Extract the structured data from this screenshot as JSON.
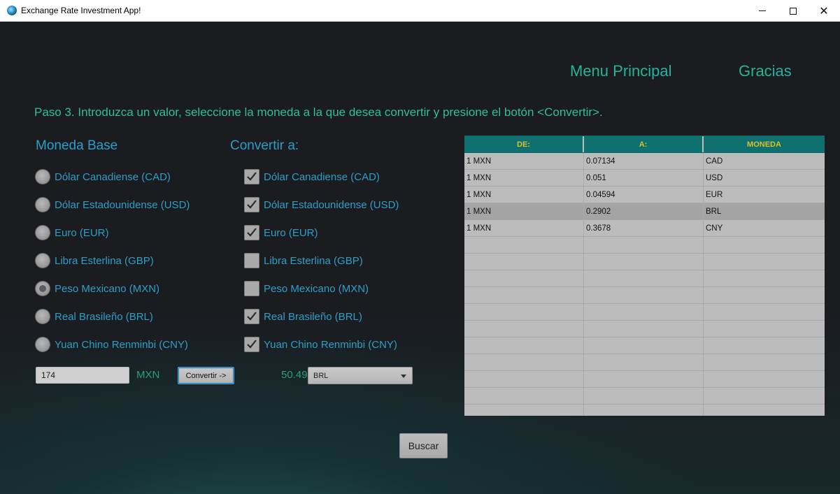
{
  "window": {
    "title": "Exchange Rate Investment App!",
    "controls": {
      "minimize": "minimize-icon",
      "maximize": "maximize-icon",
      "close": "close-icon"
    }
  },
  "nav": {
    "menu_principal": "Menu Principal",
    "gracias": "Gracias"
  },
  "instructions": "Paso 3. Introduzca un valor, seleccione la moneda a la que desea convertir y presione el botón <Convertir>.",
  "base_section": {
    "title": "Moneda Base",
    "options": [
      {
        "label": "Dólar Canadiense (CAD)",
        "selected": false
      },
      {
        "label": "Dólar Estadounidense (USD)",
        "selected": false
      },
      {
        "label": "Euro (EUR)",
        "selected": false
      },
      {
        "label": "Libra Esterlina (GBP)",
        "selected": false
      },
      {
        "label": "Peso Mexicano (MXN)",
        "selected": true
      },
      {
        "label": "Real Brasileño (BRL)",
        "selected": false
      },
      {
        "label": "Yuan Chino Renminbi (CNY)",
        "selected": false
      }
    ]
  },
  "convert_section": {
    "title": "Convertir a:",
    "options": [
      {
        "label": "Dólar Canadiense (CAD)",
        "checked": true
      },
      {
        "label": "Dólar Estadounidense (USD)",
        "checked": true
      },
      {
        "label": "Euro (EUR)",
        "checked": true
      },
      {
        "label": "Libra Esterlina (GBP)",
        "checked": false
      },
      {
        "label": "Peso Mexicano (MXN)",
        "checked": false
      },
      {
        "label": "Real Brasileño (BRL)",
        "checked": true
      },
      {
        "label": "Yuan Chino Renminbi (CNY)",
        "checked": true
      }
    ]
  },
  "converter": {
    "amount_value": "174",
    "base_code": "MXN",
    "convert_label": "Convertir ->",
    "result_value": "50.49",
    "target_currency": "BRL"
  },
  "table": {
    "headers": [
      "DE:",
      "A:",
      "MONEDA"
    ],
    "rows": [
      [
        "1 MXN",
        "0.07134",
        "CAD"
      ],
      [
        "1 MXN",
        "0.051",
        "USD"
      ],
      [
        "1 MXN",
        "0.04594",
        "EUR"
      ],
      [
        "1 MXN",
        "0.2902",
        "BRL"
      ],
      [
        "1 MXN",
        "0.3678",
        "CNY"
      ]
    ],
    "selected_row_index": 3,
    "empty_rows": 11
  },
  "search_label": "Buscar",
  "colors": {
    "accent_green": "#23b49a",
    "label_blue": "#2f9ec7",
    "table_header_bg": "#0f7070",
    "table_header_text": "#d8c22a"
  }
}
